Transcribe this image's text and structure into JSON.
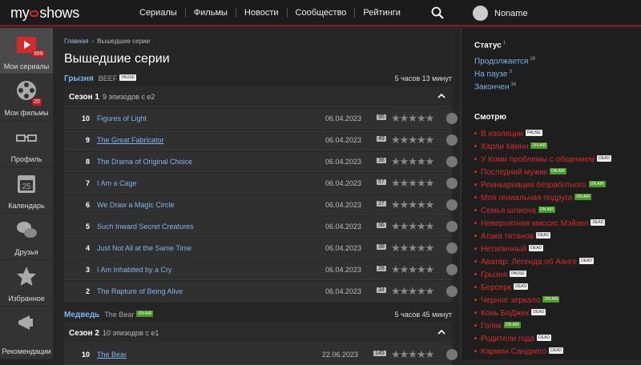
{
  "header": {
    "logo_left": "my",
    "logo_right": "shows",
    "nav": [
      "Сериалы",
      "Фильмы",
      "Новости",
      "Сообщество",
      "Рейтинги"
    ],
    "username": "Noname"
  },
  "sidebar": [
    {
      "label": "Мои сериалы",
      "badge": "999",
      "icon": "tv-play-icon"
    },
    {
      "label": "Мои фильмы",
      "badge": "20",
      "icon": "film-reel-icon"
    },
    {
      "label": "Профиль",
      "badge": "",
      "icon": "glasses-icon"
    },
    {
      "label": "Календарь",
      "badge": "",
      "icon": "calendar-icon",
      "day": "25"
    },
    {
      "label": "Друзья",
      "badge": "",
      "icon": "chat-bubbles-icon"
    },
    {
      "label": "Избранное",
      "badge": "",
      "icon": "star-icon"
    },
    {
      "label": "Рекомендации",
      "badge": "",
      "icon": "megaphone-icon"
    }
  ],
  "breadcrumb": {
    "home": "Главная",
    "current": "Вышедшие серии"
  },
  "page_title": "Вышедшие серии",
  "shows": [
    {
      "name": "Грызня",
      "original": "BEEF",
      "tag": "PAUSE",
      "time": "5 часов 13 минут",
      "season": {
        "label": "Сезон 1",
        "episodes": "9 эпизодов с e2"
      },
      "episodes": [
        {
          "num": "10",
          "title": "Figures of Light",
          "date": "06.04.2023",
          "count": "95"
        },
        {
          "num": "9",
          "title": "The Great Fabricator",
          "date": "06.04.2023",
          "count": "49"
        },
        {
          "num": "8",
          "title": "The Drama of Original Choice",
          "date": "06.04.2023",
          "count": "36"
        },
        {
          "num": "7",
          "title": "I Am a Cage",
          "date": "06.04.2023",
          "count": "57"
        },
        {
          "num": "6",
          "title": "We Draw a Magic Circle",
          "date": "06.04.2023",
          "count": "27"
        },
        {
          "num": "5",
          "title": "Such Inward Secret Creatures",
          "date": "06.04.2023",
          "count": "36"
        },
        {
          "num": "4",
          "title": "Just Not All at the Same Time",
          "date": "06.04.2023",
          "count": "38"
        },
        {
          "num": "3",
          "title": "I Am Inhabited by a Cry",
          "date": "06.04.2023",
          "count": "28"
        },
        {
          "num": "2",
          "title": "The Rapture of Being Alive",
          "date": "06.04.2023",
          "count": "34"
        }
      ]
    },
    {
      "name": "Медведь",
      "original": "The Bear",
      "tag": "ON AIR",
      "time": "5 часов 45 минут",
      "season": {
        "label": "Сезон 2",
        "episodes": "10 эпизодов с e1"
      },
      "episodes": [
        {
          "num": "10",
          "title": "The Bear",
          "date": "22.06.2023",
          "count": "145"
        }
      ]
    }
  ],
  "stars": "★★★★★",
  "status": {
    "title": "Статус",
    "count": "1",
    "items": [
      {
        "label": "Продолжается",
        "count": "26"
      },
      {
        "label": "На паузе",
        "count": "3"
      },
      {
        "label": "Закончен",
        "count": "34"
      }
    ]
  },
  "watching": {
    "title": "Смотрю",
    "items": [
      {
        "label": "В изоляции",
        "tag": "PAUSE"
      },
      {
        "label": "Харли Квинн",
        "tag": "ON AIR"
      },
      {
        "label": "У Коми проблемы с общением",
        "tag": "DEAD"
      },
      {
        "label": "Последний мужик",
        "tag": "ON AIR"
      },
      {
        "label": "Реинкарнация безработного",
        "tag": "ON AIR"
      },
      {
        "label": "Моя гениальная подруга",
        "tag": "ON AIR"
      },
      {
        "label": "Семья шпиона",
        "tag": "ON AIR"
      },
      {
        "label": "Невероятная миссис Мэйзел",
        "tag": "DEAD"
      },
      {
        "label": "Атака титанов",
        "tag": "DEAD"
      },
      {
        "label": "Нетипичный",
        "tag": "DEAD"
      },
      {
        "label": "Аватар: Легенда об Аанге",
        "tag": "DEAD"
      },
      {
        "label": "Грызня",
        "tag": "PAUSE"
      },
      {
        "label": "Берсерк",
        "tag": "DEAD"
      },
      {
        "label": "Черное зеркало",
        "tag": "ON AIR"
      },
      {
        "label": "Конь БоДжек",
        "tag": "DEAD"
      },
      {
        "label": "Голяк",
        "tag": "ON AIR"
      },
      {
        "label": "Родители года",
        "tag": "DEAD"
      },
      {
        "label": "Кармен Сандиего",
        "tag": "DEAD"
      }
    ]
  },
  "colors": {
    "accent": "#d52a2a",
    "link": "#7eb4ec",
    "onair": "#4c9a2a"
  }
}
